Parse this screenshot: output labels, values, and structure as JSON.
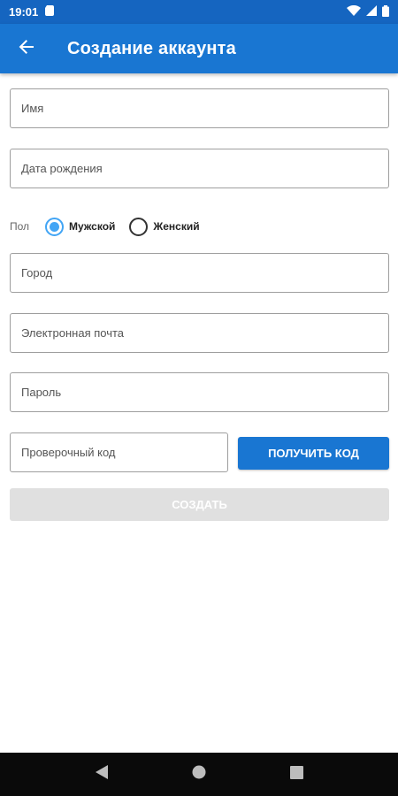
{
  "status_bar": {
    "time": "19:01",
    "icons": [
      "sim-card-icon",
      "wifi-icon",
      "signal-icon",
      "battery-icon"
    ]
  },
  "app_bar": {
    "title": "Создание аккаунта",
    "back_icon": "arrow-left-icon",
    "color": "#1976d2"
  },
  "form": {
    "name_placeholder": "Имя",
    "birthdate_placeholder": "Дата рождения",
    "gender": {
      "label": "Пол",
      "options": [
        "Мужской",
        "Женский"
      ],
      "selected": "Мужской"
    },
    "city_placeholder": "Город",
    "email_placeholder": "Электронная почта",
    "password_placeholder": "Пароль",
    "code_placeholder": "Проверочный код",
    "get_code_label": "ПОЛУЧИТЬ КОД",
    "create_label": "СОЗДАТЬ"
  },
  "nav_bar": {
    "icons": [
      "back-triangle-icon",
      "home-circle-icon",
      "recents-square-icon"
    ]
  },
  "colors": {
    "primary": "#1976d2",
    "radio_accent": "#42a5f5",
    "disabled_button": "#e0e0e0"
  }
}
